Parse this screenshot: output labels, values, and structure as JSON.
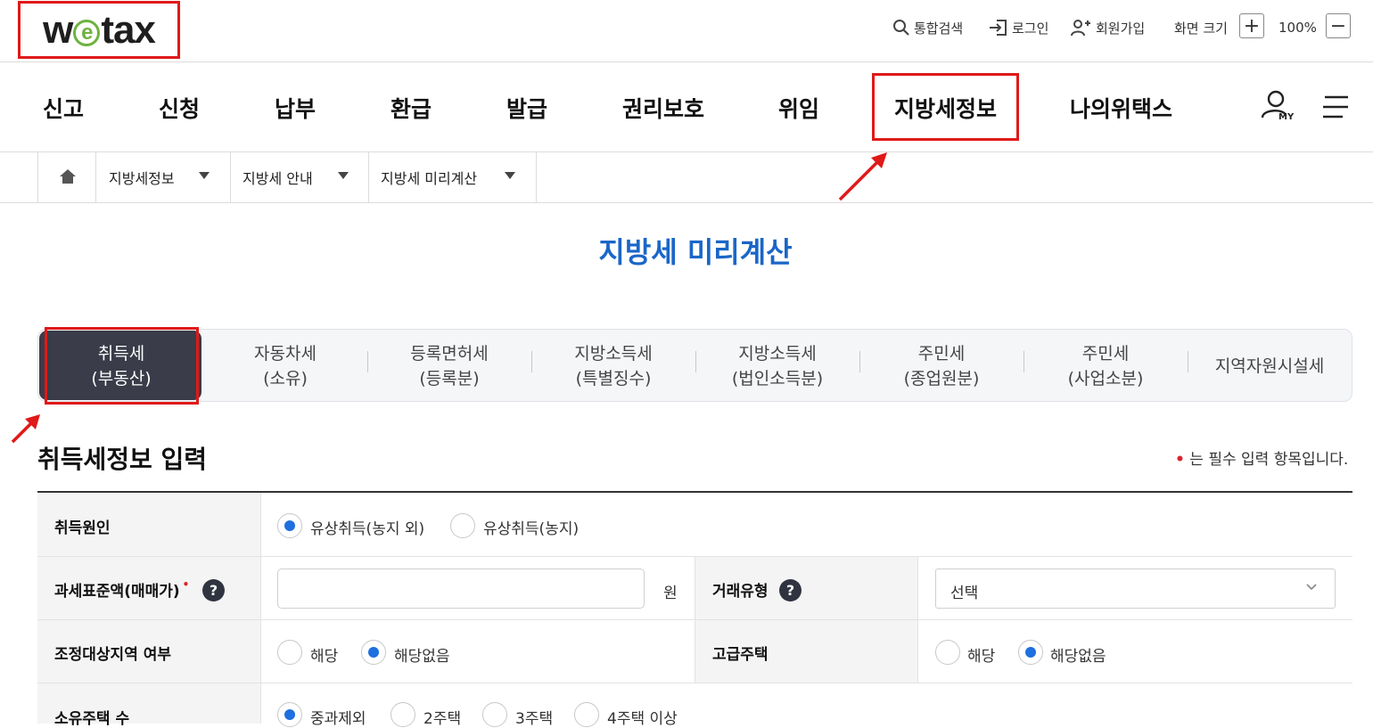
{
  "header": {
    "logo_text": "wetax",
    "utility": {
      "search": "통합검색",
      "login": "로그인",
      "join": "회원가입",
      "screen_size_label": "화면 크기",
      "zoom_in": "+",
      "zoom_level": "100%",
      "zoom_out": "−"
    }
  },
  "gnb": {
    "items": [
      "신고",
      "신청",
      "납부",
      "환급",
      "발급",
      "권리보호",
      "위임",
      "지방세정보",
      "나의위택스"
    ],
    "my_label": "MY"
  },
  "breadcrumb": {
    "items": [
      "지방세정보",
      "지방세 안내",
      "지방세 미리계산"
    ]
  },
  "page": {
    "title": "지방세 미리계산"
  },
  "tabs": [
    {
      "line1": "취득세",
      "line2": "(부동산)",
      "active": true
    },
    {
      "line1": "자동차세",
      "line2": "(소유)"
    },
    {
      "line1": "등록면허세",
      "line2": "(등록분)"
    },
    {
      "line1": "지방소득세",
      "line2": "(특별징수)"
    },
    {
      "line1": "지방소득세",
      "line2": "(법인소득분)"
    },
    {
      "line1": "주민세",
      "line2": "(종업원분)"
    },
    {
      "line1": "주민세",
      "line2": "(사업소분)"
    },
    {
      "line1": "지역자원시설세",
      "line2": ""
    }
  ],
  "section": {
    "title": "취득세정보 입력",
    "required_note": "는 필수 입력 항목입니다.",
    "required_mark": "•"
  },
  "form": {
    "acquisition_cause": {
      "label": "취득원인",
      "options": [
        "유상취득(농지 외)",
        "유상취득(농지)"
      ],
      "selected": 0
    },
    "tax_base": {
      "label": "과세표준액(매매가)",
      "help": "?",
      "value": "",
      "unit": "원"
    },
    "trade_type": {
      "label": "거래유형",
      "help": "?",
      "selected_text": "선택"
    },
    "adjusted_area": {
      "label": "조정대상지역 여부",
      "options": [
        "해당",
        "해당없음"
      ],
      "selected": 1
    },
    "luxury_house": {
      "label": "고급주택",
      "options": [
        "해당",
        "해당없음"
      ],
      "selected": 1
    },
    "houses_owned": {
      "label": "소유주택 수",
      "options": [
        "중과제외",
        "2주택",
        "3주택",
        "4주택 이상"
      ],
      "selected": 0
    }
  },
  "colors": {
    "accent_blue": "#1a66c8",
    "radio_blue": "#1e6fe0",
    "tab_active_bg": "#3a3c49",
    "highlight_red": "#e01919",
    "required_red": "#d9232c"
  }
}
